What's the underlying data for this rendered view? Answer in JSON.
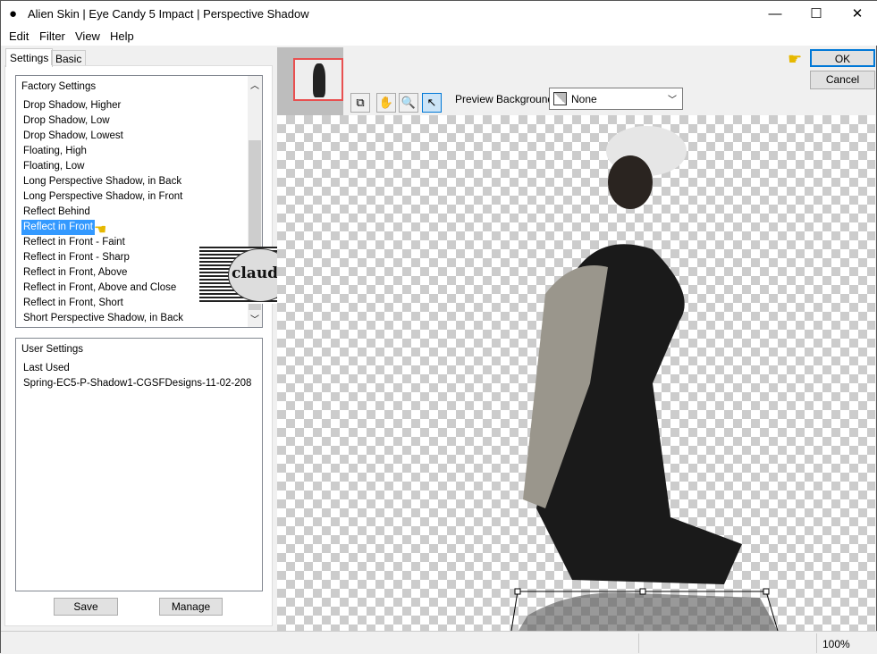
{
  "window": {
    "title": "Alien Skin | Eye Candy 5 Impact | Perspective Shadow",
    "minimize": "—",
    "maximize": "☐",
    "close": "✕"
  },
  "menu": [
    "Edit",
    "Filter",
    "View",
    "Help"
  ],
  "tabs": [
    "Settings",
    "Basic"
  ],
  "factory": {
    "header": "Factory Settings",
    "items": [
      "Drop Shadow, Higher",
      "Drop Shadow, Low",
      "Drop Shadow, Lowest",
      "Floating, High",
      "Floating, Low",
      "Long Perspective Shadow, in Back",
      "Long Perspective Shadow, in Front",
      "Reflect Behind",
      "Reflect in Front",
      "Reflect in Front - Faint",
      "Reflect in Front - Sharp",
      "Reflect in Front, Above",
      "Reflect in Front, Above and Close",
      "Reflect in Front, Short",
      "Short Perspective Shadow, in Back"
    ],
    "selected": "Reflect in Front"
  },
  "user": {
    "header": "User Settings",
    "items": [
      "Last Used",
      "Spring-EC5-P-Shadow1-CGSFDesigns-11-02-208"
    ]
  },
  "buttons": {
    "save": "Save",
    "manage": "Manage",
    "ok": "OK",
    "cancel": "Cancel"
  },
  "preview_bg": {
    "label": "Preview Background:",
    "value": "None"
  },
  "watermark": "claudia",
  "status": {
    "zoom": "100%"
  },
  "colors": {
    "selection": "#3399ff",
    "ok_border": "#0078d7"
  }
}
